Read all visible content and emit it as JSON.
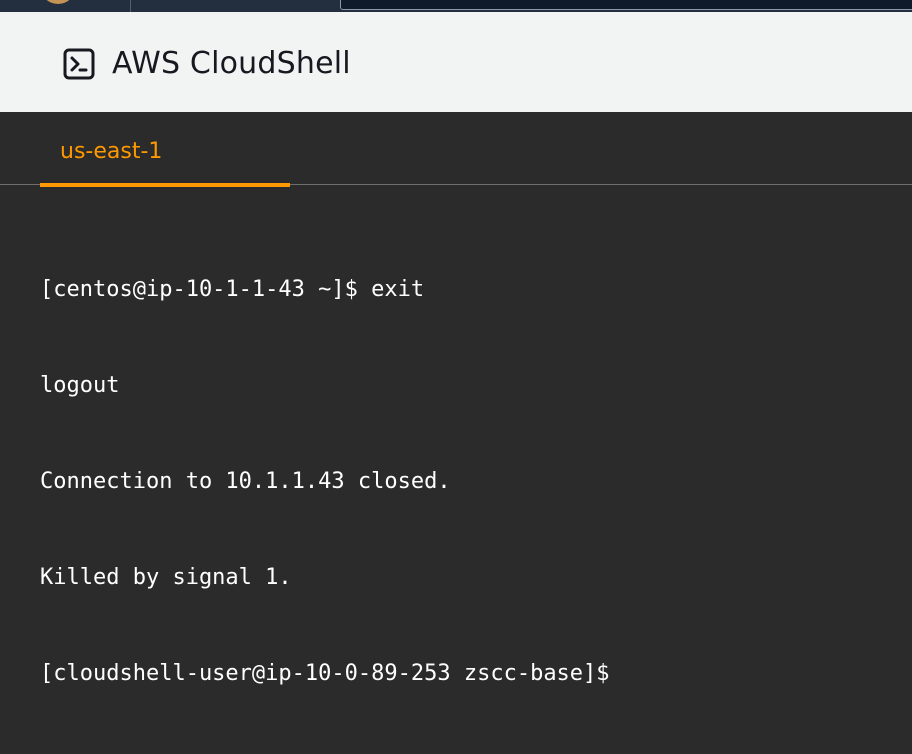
{
  "header": {
    "title": "AWS CloudShell",
    "icon": "terminal-icon"
  },
  "tabs": [
    {
      "label": "us-east-1",
      "active": true
    }
  ],
  "terminal": {
    "lines": [
      "[centos@ip-10-1-1-43 ~]$ exit",
      "logout",
      "Connection to 10.1.1.43 closed.",
      "Killed by signal 1.",
      "[cloudshell-user@ip-10-0-89-253 zscc-base]$"
    ]
  },
  "colors": {
    "accent": "#ff9900",
    "terminal_bg": "#2b2b2b",
    "header_bg": "#f2f3f3",
    "nav_bg": "#232f3e"
  }
}
